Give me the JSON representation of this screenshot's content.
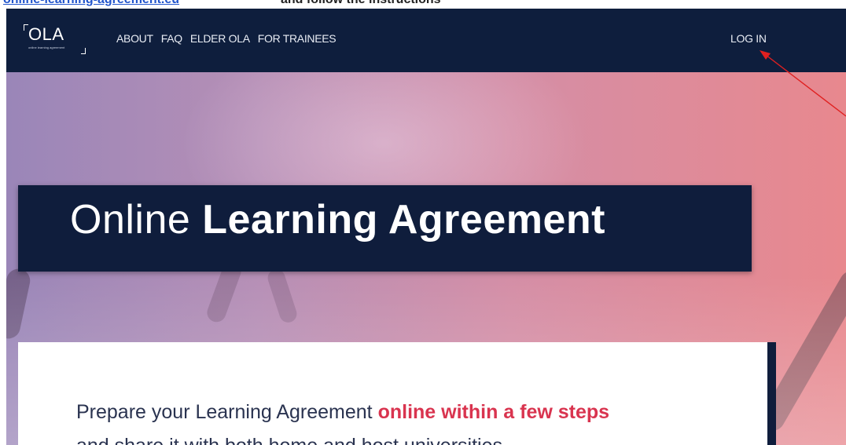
{
  "doc_strip": {
    "link_text": "online-learning-agreement.eu",
    "rest_text": "and follow the instructions"
  },
  "nav": {
    "logo": {
      "text": "OLA",
      "subtext": "online learning agreement"
    },
    "links": [
      {
        "label": "ABOUT"
      },
      {
        "label": "FAQ"
      },
      {
        "label": "ELDER OLA"
      },
      {
        "label": "FOR TRAINEES"
      }
    ],
    "login_label": "LOG IN"
  },
  "hero": {
    "title_light": "Online",
    "title_bold": "Learning Agreement"
  },
  "card": {
    "line1_prefix": "Prepare your Learning Agreement",
    "line1_accent": "online within a few steps",
    "line2": "and share it with both home and host universities"
  },
  "colors": {
    "navbar": "#0e1e3d",
    "accent": "#d9344f",
    "annotation_arrow": "#e02020"
  },
  "annotation": {
    "icon": "red-arrow-icon"
  }
}
